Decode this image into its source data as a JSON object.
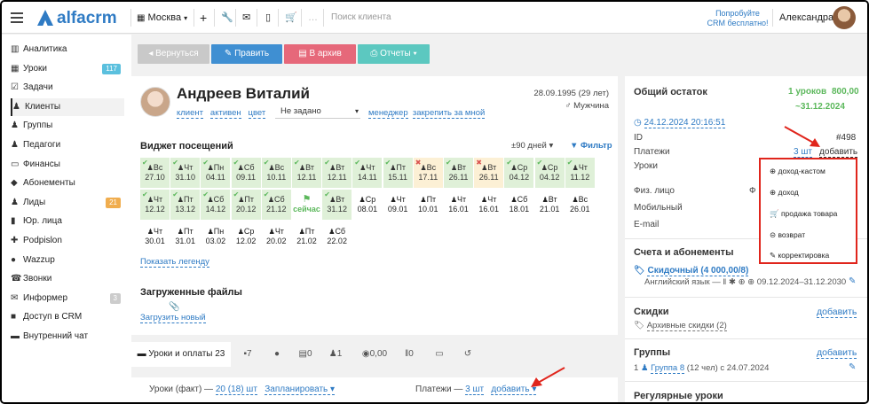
{
  "topbar": {
    "brand": "alfacrm",
    "city": "Москва",
    "search_placeholder": "Поиск клиента",
    "promo": "Попробуйте CRM бесплатно!",
    "user": "Александра"
  },
  "sidebar": {
    "items": [
      {
        "label": "Аналитика",
        "icon": "chart-icon"
      },
      {
        "label": "Уроки",
        "icon": "calendar-icon",
        "badge": "117",
        "badge_color": "#5bc0de"
      },
      {
        "label": "Задачи",
        "icon": "tasks-icon"
      },
      {
        "label": "Клиенты",
        "icon": "user-icon",
        "active": true
      },
      {
        "label": "Группы",
        "icon": "users-icon"
      },
      {
        "label": "Педагоги",
        "icon": "teacher-icon"
      },
      {
        "label": "Финансы",
        "icon": "finance-icon"
      },
      {
        "label": "Абонементы",
        "icon": "tag-icon"
      },
      {
        "label": "Лиды",
        "icon": "funnel-icon",
        "badge": "21",
        "badge_color": "#f0ad4e"
      },
      {
        "label": "Юр. лица",
        "icon": "building-icon"
      },
      {
        "label": "Podpislon",
        "icon": "puzzle-icon"
      },
      {
        "label": "Wazzup",
        "icon": "chat-icon"
      },
      {
        "label": "Звонки",
        "icon": "phone-icon"
      },
      {
        "label": "Информер",
        "icon": "mail-icon",
        "badge": "3",
        "badge_color": "#ccc"
      },
      {
        "label": "Доступ в CRM",
        "icon": "lock-icon"
      },
      {
        "label": "Внутренний чат",
        "icon": "chat-box-icon"
      }
    ]
  },
  "actions": {
    "back": "Вернуться",
    "edit": "Править",
    "archive": "В архив",
    "reports": "Отчеты"
  },
  "client": {
    "name": "Андреев Виталий",
    "birth": "28.09.1995 (29 лет)",
    "gender": "Мужчина",
    "meta": [
      "клиент",
      "активен",
      "цвет"
    ],
    "status_select": "Не задано",
    "manager": "менеджер",
    "assign": "закрепить за мной"
  },
  "attendance": {
    "title": "Виджет посещений",
    "period": "±90 дней",
    "filter": "Фильтр",
    "legend": "Показать легенду",
    "row1": [
      [
        "Вс",
        "27.10",
        "g"
      ],
      [
        "Чт",
        "31.10",
        "g"
      ],
      [
        "Пн",
        "04.11",
        "g"
      ],
      [
        "Сб",
        "09.11",
        "g"
      ],
      [
        "Вс",
        "10.11",
        "g"
      ],
      [
        "Вт",
        "12.11",
        "g"
      ],
      [
        "Вт",
        "12.11",
        "g"
      ],
      [
        "Чт",
        "14.11",
        "g"
      ],
      [
        "Пт",
        "15.11",
        "g"
      ],
      [
        "Вс",
        "17.11",
        "y"
      ],
      [
        "Вт",
        "26.11",
        "g"
      ],
      [
        "Вт",
        "26.11",
        "y"
      ],
      [
        "Ср",
        "04.12",
        "g"
      ],
      [
        "Ср",
        "04.12",
        "g"
      ],
      [
        "Чт",
        "11.12",
        "g"
      ]
    ],
    "row2": [
      [
        "Чт",
        "12.12",
        "g"
      ],
      [
        "Пт",
        "13.12",
        "g"
      ],
      [
        "Сб",
        "14.12",
        "g"
      ],
      [
        "Пт",
        "20.12",
        "g"
      ],
      [
        "Сб",
        "21.12",
        "g"
      ],
      [
        "",
        "сейчас",
        "now"
      ],
      [
        "Вт",
        "31.12",
        "g"
      ],
      [
        "Ср",
        "08.01",
        "w"
      ],
      [
        "Чт",
        "09.01",
        "w"
      ],
      [
        "Пт",
        "10.01",
        "w"
      ],
      [
        "Чт",
        "16.01",
        "w"
      ],
      [
        "Чт",
        "16.01",
        "w"
      ],
      [
        "Сб",
        "18.01",
        "w"
      ],
      [
        "Вт",
        "21.01",
        "w"
      ],
      [
        "Вс",
        "26.01",
        "w"
      ]
    ],
    "row3": [
      [
        "Чт",
        "30.01",
        "w"
      ],
      [
        "Пт",
        "31.01",
        "w"
      ],
      [
        "Пн",
        "03.02",
        "w"
      ],
      [
        "Ср",
        "12.02",
        "w"
      ],
      [
        "Чт",
        "20.02",
        "w"
      ],
      [
        "Пт",
        "21.02",
        "w"
      ],
      [
        "Сб",
        "22.02",
        "w"
      ]
    ]
  },
  "files": {
    "title": "Загруженные файлы",
    "upload": "Загрузить новый"
  },
  "tabs": [
    {
      "label": "Уроки и оплаты 23"
    },
    {
      "label": "7"
    },
    {
      "label": ""
    },
    {
      "label": "0"
    },
    {
      "label": "1"
    },
    {
      "label": "0,00"
    },
    {
      "label": "0"
    },
    {
      "label": ""
    },
    {
      "label": ""
    }
  ],
  "lessons": {
    "fact_label": "Уроки (факт) —",
    "fact_value": "20 (18) шт",
    "planned": "Запланировать",
    "payments_label": "Платежи —",
    "payments_value": "3 шт",
    "add": "добавить"
  },
  "right": {
    "balance_title": "Общий остаток",
    "balance_lessons": "1 уроков",
    "balance_sum": "800,00",
    "balance_date": "~31.12.2024",
    "timestamp": "24.12.2024 20:16:51",
    "id_label": "ID",
    "id_value": "#498",
    "payments_label": "Платежи",
    "payments_value": "3 шт",
    "payments_add": "добавить",
    "lessons_label": "Уроки",
    "fiz": "Физ. лицо",
    "fiz_trunc": "Ф",
    "mobile": "Мобильный",
    "email": "E-mail",
    "subs_title": "Счета и абонементы",
    "sub_name": "Скидочный (4 000,00/8)",
    "sub_lang": "Английский язык —",
    "sub_dates": "09.12.2024–31.12.2030",
    "discounts": "Скидки",
    "discounts_add": "добавить",
    "archive_discounts": "Архивные скидки (2)",
    "groups": "Группы",
    "groups_add": "добавить",
    "group_item": "Группа 8",
    "group_meta": "(12 чел) с 24.07.2024",
    "regular": "Регулярные уроки"
  },
  "menu": {
    "items": [
      "доход-кастом",
      "доход",
      "продажа товара",
      "возврат",
      "корректировка"
    ]
  }
}
